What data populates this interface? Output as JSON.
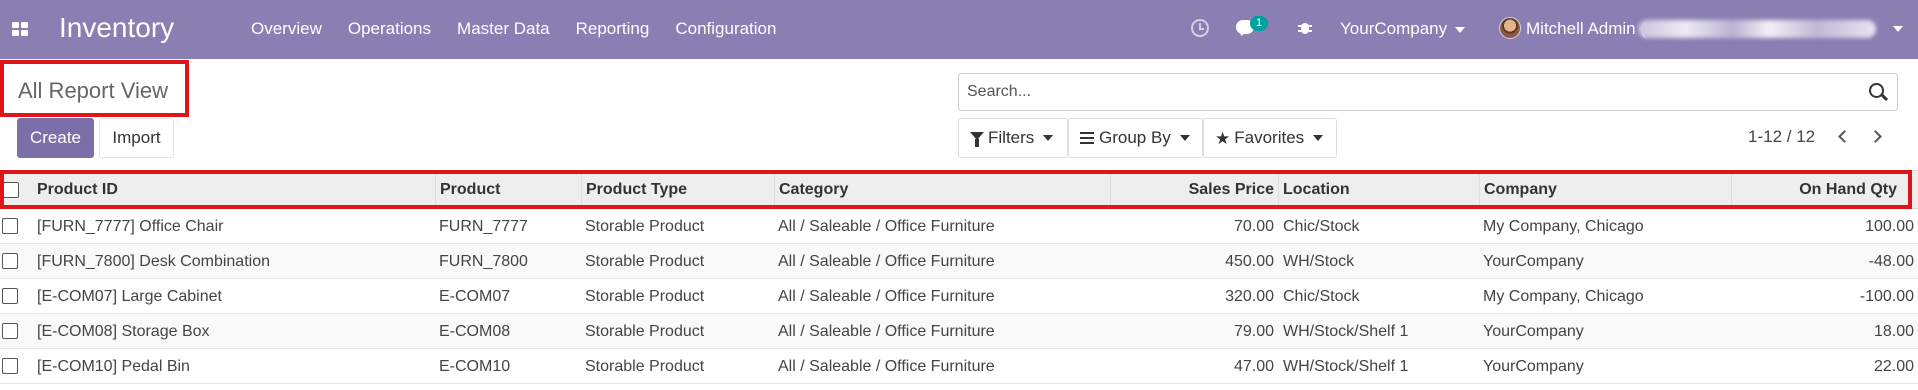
{
  "navbar": {
    "brand": "Inventory",
    "menu": [
      "Overview",
      "Operations",
      "Master Data",
      "Reporting",
      "Configuration"
    ],
    "chat_count": "1",
    "company": "YourCompany",
    "user": "Mitchell Admin (",
    "icons": [
      "apps-icon",
      "clock-icon",
      "chat-icon",
      "bug-icon",
      "avatar"
    ]
  },
  "page": {
    "title": "All Report View",
    "search_placeholder": "Search...",
    "create_label": "Create",
    "import_label": "Import",
    "filters_label": "Filters",
    "groupby_label": "Group By",
    "favorites_label": "Favorites",
    "pager": "1-12 / 12"
  },
  "table": {
    "columns": [
      "Product ID",
      "Product",
      "Product Type",
      "Category",
      "Sales Price",
      "Location",
      "Company",
      "On Hand Qty"
    ],
    "rows": [
      [
        "[FURN_7777] Office Chair",
        "FURN_7777",
        "Storable Product",
        "All / Saleable / Office Furniture",
        "70.00",
        "Chic/Stock",
        "My Company, Chicago",
        "100.00"
      ],
      [
        "[FURN_7800] Desk Combination",
        "FURN_7800",
        "Storable Product",
        "All / Saleable / Office Furniture",
        "450.00",
        "WH/Stock",
        "YourCompany",
        "-48.00"
      ],
      [
        "[E-COM07] Large Cabinet",
        "E-COM07",
        "Storable Product",
        "All / Saleable / Office Furniture",
        "320.00",
        "Chic/Stock",
        "My Company, Chicago",
        "-100.00"
      ],
      [
        "[E-COM08] Storage Box",
        "E-COM08",
        "Storable Product",
        "All / Saleable / Office Furniture",
        "79.00",
        "WH/Stock/Shelf 1",
        "YourCompany",
        "18.00"
      ],
      [
        "[E-COM10] Pedal Bin",
        "E-COM10",
        "Storable Product",
        "All / Saleable / Office Furniture",
        "47.00",
        "WH/Stock/Shelf 1",
        "YourCompany",
        "22.00"
      ]
    ]
  },
  "colors": {
    "navbar": "#8a7eb3",
    "primary_button": "#7c6fa9",
    "highlight_box": "#e0151b",
    "chat_badge": "#00a09d"
  }
}
